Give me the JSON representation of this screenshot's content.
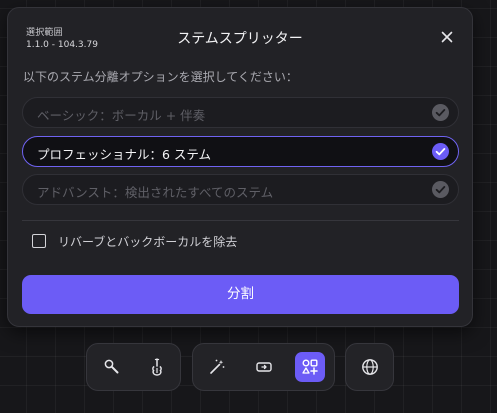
{
  "dialog": {
    "range_label": "選択範囲",
    "range_value": "1.1.0 - 104.3.79",
    "title": "ステムスプリッター",
    "instruction": "以下のステム分離オプションを選択してください：",
    "options": [
      {
        "label": "ベーシック：ボーカル + 伴奏",
        "selected": false
      },
      {
        "label": "プロフェッショナル：6 ステム",
        "selected": true
      },
      {
        "label": "アドバンスト：検出されたすべてのステム",
        "selected": false
      }
    ],
    "checkbox": {
      "label": "リバーブとバックボーカルを除去",
      "checked": false
    },
    "split_label": "分割",
    "close_icon": "close-icon"
  },
  "toolbar": {
    "groups": [
      {
        "tools": [
          {
            "icon": "microphone-icon",
            "active": false
          },
          {
            "icon": "guitar-icon",
            "active": false
          }
        ]
      },
      {
        "tools": [
          {
            "icon": "magic-wand-icon",
            "active": false
          },
          {
            "icon": "swap-icon",
            "active": false
          },
          {
            "icon": "shapes-add-icon",
            "active": true
          }
        ]
      },
      {
        "tools": [
          {
            "icon": "globe-icon",
            "active": false
          }
        ]
      }
    ]
  },
  "colors": {
    "accent": "#6c5cf6",
    "background": "#17171a",
    "panel": "#222226"
  }
}
